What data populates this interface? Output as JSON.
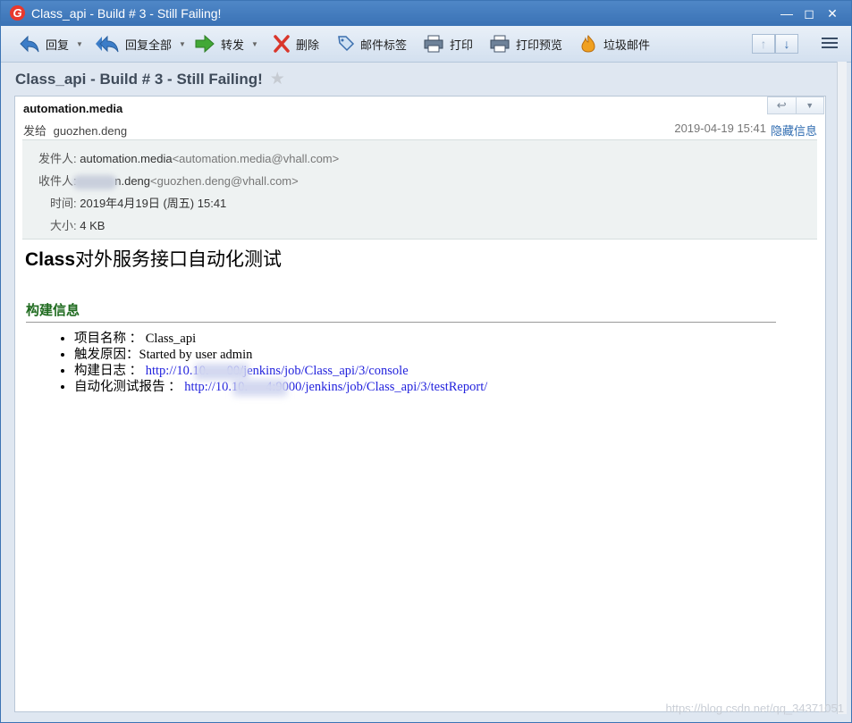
{
  "window": {
    "title": "Class_api - Build # 3 - Still Failing!",
    "logo": "G",
    "controls": [
      "minimize",
      "maximize",
      "close"
    ]
  },
  "toolbar": {
    "items": [
      {
        "label": "回复",
        "icon": "reply-icon",
        "dropdown": true
      },
      {
        "label": "回复全部",
        "icon": "reply-all-icon",
        "dropdown": true
      },
      {
        "label": "转发",
        "icon": "forward-icon",
        "dropdown": true
      },
      {
        "label": "删除",
        "icon": "delete-icon",
        "dropdown": false
      },
      {
        "label": "邮件标签",
        "icon": "tag-icon",
        "dropdown": false
      },
      {
        "label": "打印",
        "icon": "printer-icon",
        "dropdown": false
      },
      {
        "label": "打印预览",
        "icon": "print-preview-icon",
        "dropdown": false
      },
      {
        "label": "垃圾邮件",
        "icon": "junk-icon",
        "dropdown": false
      }
    ],
    "nav": {
      "up": "↑",
      "down": "↓"
    }
  },
  "message": {
    "subject": "Class_api - Build # 3 - Still Failing!",
    "sender": "automation.media",
    "sendto_label": "发给",
    "sendto": "guozhen.deng",
    "date": "2019-04-19 15:41",
    "hide_link": "隐藏信息",
    "details": {
      "from_label": "发件人:",
      "from_name": "automation.media",
      "from_email": "<automation.media@vhall.com>",
      "to_label": "收件人:",
      "to_name_visible": "n.deng",
      "to_email": "<guozhen.deng@vhall.com>",
      "time_label": "时间:",
      "time": "2019年4月19日 (周五) 15:41",
      "size_label": "大小:",
      "size": "4 KB"
    },
    "body": {
      "title_bold": "Class",
      "title_rest": "对外服务接口自动化测试",
      "section": "构建信息",
      "items": [
        {
          "label": "项目名称 ：",
          "value": "Class_api"
        },
        {
          "label": "触发原因：",
          "value": "Started by user admin"
        },
        {
          "label": "构建日志 ：",
          "link_pre": "http://10.10.",
          "link_post": "00/jenkins/job/Class_api/3/console"
        },
        {
          "label": "自动化测试报告 ：",
          "link_pre": "http://10.10.",
          "link_post": "4:9000/jenkins/job/Class_api/3/testReport/"
        }
      ]
    }
  },
  "watermark": "https://blog.csdn.net/qq_34371051"
}
